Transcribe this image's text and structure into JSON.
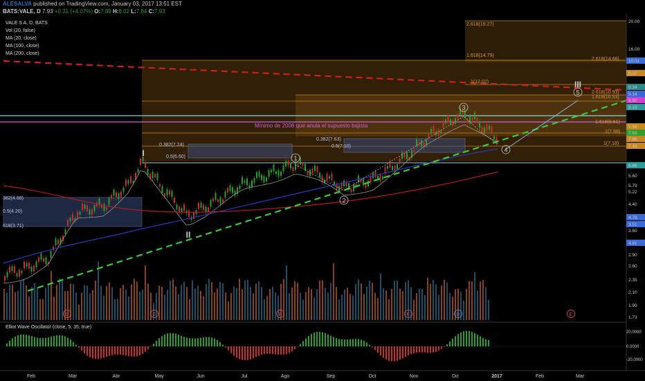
{
  "header": {
    "author": "ALESALVA",
    "published": "published on TradingView.com, January 03, 2017 13:51 EST",
    "quote_prefix": "BATS:VALE, D",
    "last": "7.93",
    "change": "+0.31 (+4.07%)",
    "o_label": "O:",
    "o_value": "7.89",
    "h_label": "H:",
    "h_value": "8.02",
    "l_label": "L:",
    "l_value": "7.84",
    "c_label": "C:",
    "c_value": "7.93"
  },
  "legend": {
    "symbol_title": "VALE S A, D, BATS",
    "indicators": [
      "Vol (20, false)",
      "MA (20, close)",
      "MA (100, close)",
      "MA (200, close)"
    ]
  },
  "oscillator": {
    "title": "Elliot Wave Oscillator (close, 5, 35, true)",
    "axis": [
      "20.0000",
      "0.0000",
      "-20.0000"
    ]
  },
  "price_axis": {
    "labels": [
      "20.00",
      "16.00",
      "12.60",
      "10.01",
      "9.37",
      "9.34",
      "9.14",
      "8.80",
      "8.19",
      "7.98",
      "7.93",
      "7.86",
      "7.43",
      "6.86",
      "5.60",
      "5.79",
      "5.22",
      "4.40",
      "4.78",
      "3.51",
      "3.60",
      "4.91",
      "2.90",
      "2.60",
      "2.35",
      "2.10",
      "1.90",
      "1.73"
    ]
  },
  "time_axis": [
    "Feb",
    "Mar",
    "Abr",
    "May",
    "Jun",
    "Jul",
    "Ago",
    "Sep",
    "Oct",
    "Nov",
    "Dic",
    "2017",
    "Feb",
    "Mar"
  ],
  "fib_labels": {
    "top": [
      "2.618(19.27)",
      "1.618(14.79)",
      "2.618(14.66)",
      "1(12.02)",
      "2.618(10.93)",
      "1.618(10.53)",
      "1.618(8.61)",
      "1(7.98)",
      "1(7.18)"
    ],
    "mid": [
      "0.382(7.63)",
      "0.5(7.10)",
      "0.382(7.24)",
      "0.5(6.60)"
    ],
    "left": [
      "382(4.68)",
      "0.5(4.20)",
      "618(3.71)"
    ]
  },
  "annotation": "Mínimo de 2008 que anula el supuesto bajista",
  "waves": [
    "I",
    "II",
    "III",
    "1",
    "2",
    "3",
    "4",
    "5"
  ],
  "events": [
    "D",
    "E",
    "E",
    "E",
    "D",
    "E"
  ],
  "colors": {
    "bg": "#000000",
    "up": "#2e9e2e",
    "down": "#c23030",
    "fib": "#c8881e",
    "trend_green": "#3ec83e",
    "trend_red": "#d02020",
    "ma_blue": "#2a3ab8",
    "ma_red": "#b01c1c",
    "volume": "#2a6a8a"
  }
}
